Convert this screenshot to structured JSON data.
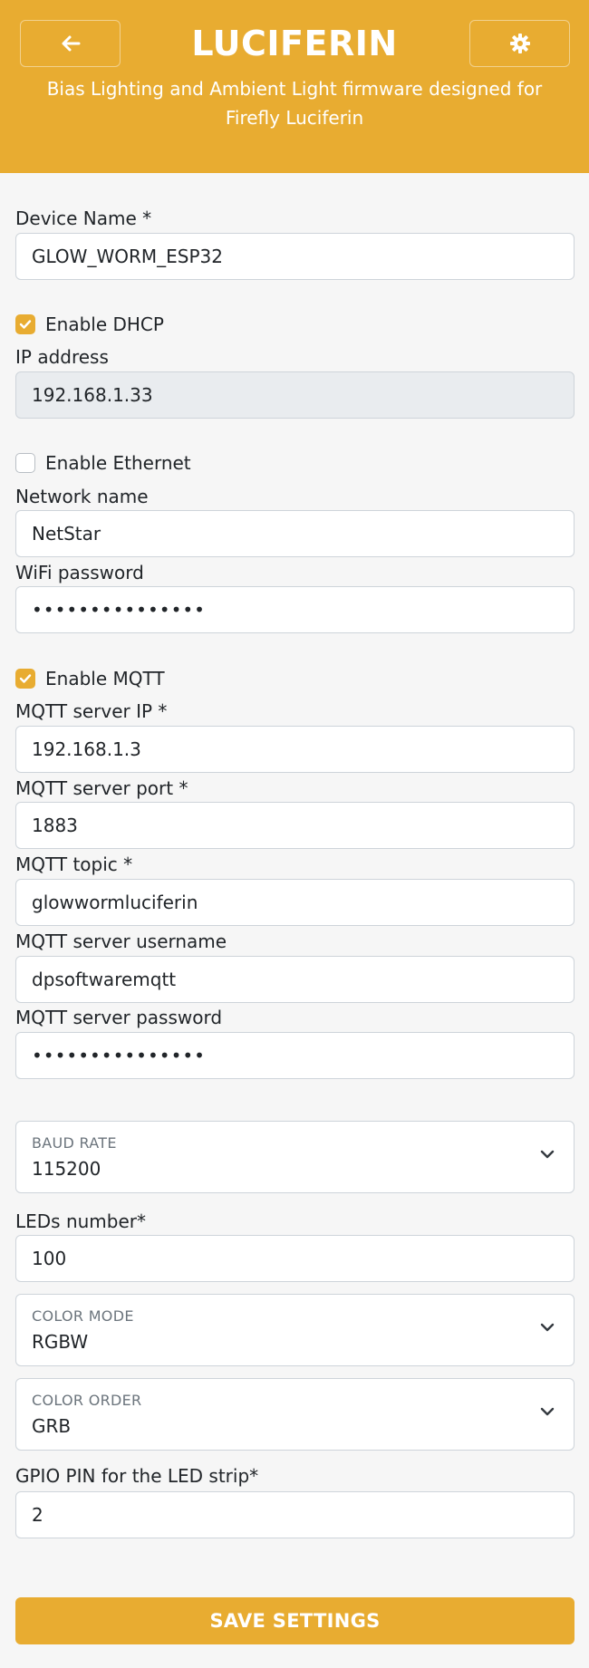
{
  "header": {
    "title": "LUCIFERIN",
    "subtitle": "Bias Lighting and Ambient Light firmware designed for Firefly Luciferin",
    "back_icon": "arrow-left-icon",
    "settings_icon": "gear-icon",
    "background_color": "#e8ac31"
  },
  "form": {
    "device_name": {
      "label": "Device Name *",
      "value": "GLOW_WORM_ESP32"
    },
    "dhcp": {
      "label": "Enable DHCP",
      "checked": true
    },
    "ip_address": {
      "label": "IP address",
      "value": "192.168.1.33",
      "disabled": true
    },
    "ethernet": {
      "label": "Enable Ethernet",
      "checked": false
    },
    "network_name": {
      "label": "Network name",
      "value": "NetStar"
    },
    "wifi_password": {
      "label": "WiFi password",
      "value": "•••••••••••••••"
    },
    "mqtt": {
      "label": "Enable MQTT",
      "checked": true
    },
    "mqtt_server_ip": {
      "label": "MQTT server IP *",
      "value": "192.168.1.3"
    },
    "mqtt_server_port": {
      "label": "MQTT server port *",
      "value": "1883"
    },
    "mqtt_topic": {
      "label": "MQTT topic *",
      "value": "glowwormluciferin"
    },
    "mqtt_username": {
      "label": "MQTT server username",
      "value": "dpsoftwaremqtt"
    },
    "mqtt_password": {
      "label": "MQTT server password",
      "value": "•••••••••••••••"
    },
    "baud_rate": {
      "label": "BAUD RATE",
      "value": "115200"
    },
    "leds_number": {
      "label": "LEDs number*",
      "value": "100"
    },
    "color_mode": {
      "label": "COLOR MODE",
      "value": "RGBW"
    },
    "color_order": {
      "label": "COLOR ORDER",
      "value": "GRB"
    },
    "gpio_pin": {
      "label": "GPIO PIN for the LED strip*",
      "value": "2"
    }
  },
  "actions": {
    "save_label": "SAVE SETTINGS"
  },
  "colors": {
    "accent": "#e8ac31",
    "page_background": "#f6f6f6",
    "disabled_field": "#e9ecef"
  }
}
